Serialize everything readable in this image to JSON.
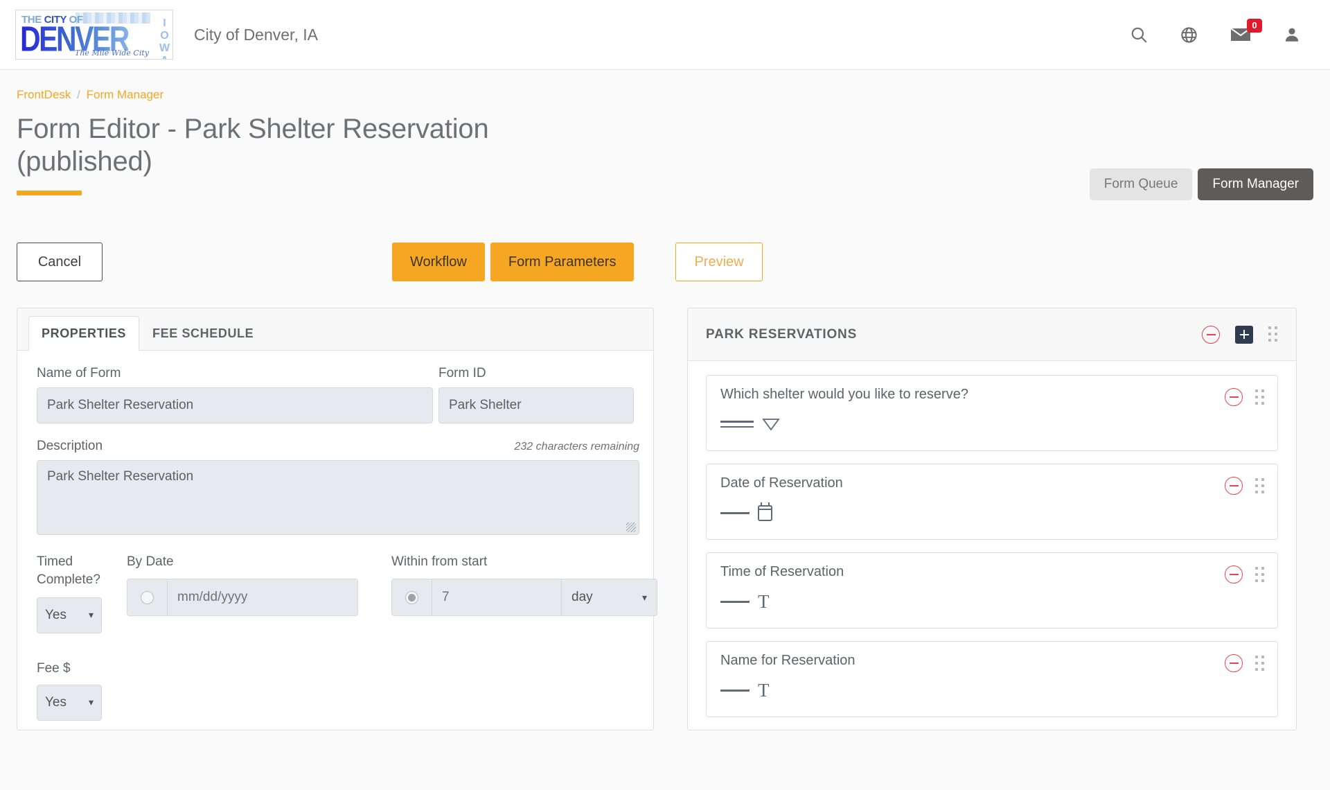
{
  "topbar": {
    "logo": {
      "line_top": "THE CITY OF",
      "main": "DENVER",
      "state": "IOWA",
      "tagline": "The Mile Wide City"
    },
    "brand_title": "City of Denver, IA",
    "icons": {
      "search": "search-icon",
      "globe": "globe-icon",
      "mail": "mail-icon",
      "mail_badge": "0",
      "user": "user-icon"
    }
  },
  "breadcrumb": {
    "items": [
      "FrontDesk",
      "Form Manager"
    ],
    "separator": "/"
  },
  "page": {
    "title": "Form Editor - Park Shelter Reservation (published)"
  },
  "view_toggle": {
    "queue_label": "Form Queue",
    "manager_label": "Form Manager",
    "active": "Form Manager"
  },
  "actions": {
    "cancel": "Cancel",
    "workflow": "Workflow",
    "form_parameters": "Form Parameters",
    "preview": "Preview"
  },
  "left_panel": {
    "tabs": [
      {
        "label": "PROPERTIES",
        "active": true
      },
      {
        "label": "FEE SCHEDULE",
        "active": false
      }
    ],
    "name_of_form": {
      "label": "Name of Form",
      "value": "Park Shelter Reservation"
    },
    "form_id": {
      "label": "Form ID",
      "value": "Park Shelter"
    },
    "description": {
      "label": "Description",
      "counter": "232 characters remaining",
      "value": "Park Shelter Reservation"
    },
    "timed_complete": {
      "label": "Timed Complete?",
      "value": "Yes"
    },
    "by_date": {
      "label": "By Date",
      "selected": false,
      "placeholder": "mm/dd/yyyy",
      "value": ""
    },
    "within_from_start": {
      "label": "Within from start",
      "selected": true,
      "value": "7",
      "unit": "day"
    },
    "fee": {
      "label": "Fee $",
      "value": "Yes"
    }
  },
  "right_panel": {
    "section_title": "PARK RESERVATIONS",
    "tools": {
      "remove": "minus-circle-icon",
      "add": "plus-square-icon",
      "drag": "drag-handle-icon"
    },
    "fields": [
      {
        "label": "Which shelter would you like to reserve?",
        "widget": "dropdown"
      },
      {
        "label": "Date of Reservation",
        "widget": "date"
      },
      {
        "label": "Time of Reservation",
        "widget": "text"
      },
      {
        "label": "Name for Reservation",
        "widget": "text"
      }
    ]
  },
  "colors": {
    "accent_orange": "#f5a623",
    "active_dark": "#5e5b58",
    "danger_red": "#e8414a",
    "input_bg": "#e6eaee",
    "page_bg": "#fafafa"
  }
}
